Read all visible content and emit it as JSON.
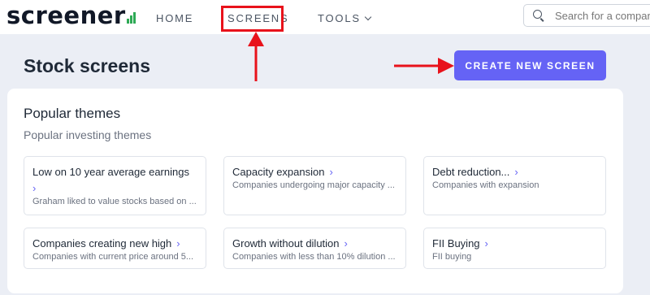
{
  "brand": {
    "name": "screener"
  },
  "nav": {
    "home": "HOME",
    "screens": "SCREENS",
    "tools": "TOOLS"
  },
  "search": {
    "placeholder": "Search for a company"
  },
  "page": {
    "title": "Stock screens",
    "create_button": "CREATE NEW SCREEN"
  },
  "themes": {
    "title": "Popular themes",
    "subtitle": "Popular investing themes",
    "items": [
      {
        "name": "Low on 10 year average earnings",
        "arrow": "›",
        "desc": "Graham liked to value stocks based on ..."
      },
      {
        "name": "Capacity expansion",
        "arrow": "›",
        "desc": "Companies undergoing major capacity ..."
      },
      {
        "name": "Debt reduction...",
        "arrow": "›",
        "desc": "Companies with expansion"
      },
      {
        "name": "Companies creating new high",
        "arrow": "›",
        "desc": "Companies with current price around 5..."
      },
      {
        "name": "Growth without dilution",
        "arrow": "›",
        "desc": "Companies with less than 10% dilution ..."
      },
      {
        "name": "FII Buying",
        "arrow": "›",
        "desc": "FII buying"
      }
    ]
  },
  "colors": {
    "accent": "#6563f5",
    "annotation_red": "#e8121b",
    "logo_green": "#2eaa55",
    "page_bg": "#ebeef5"
  },
  "icons": [
    "search-icon",
    "chevron-down-icon",
    "logo-bars-icon",
    "chevron-right-icon"
  ]
}
